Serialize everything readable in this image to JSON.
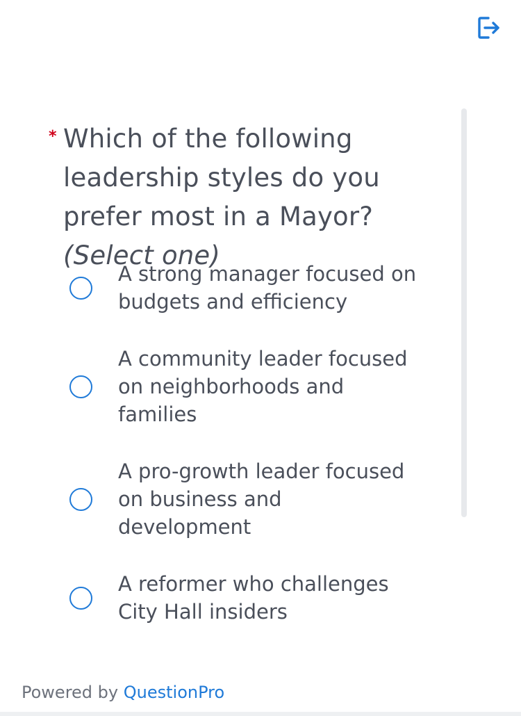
{
  "header": {
    "exit_icon": "exit-icon"
  },
  "question": {
    "required_mark": "*",
    "text": "Which of the following leadership styles do you prefer most in a Mayor?",
    "hint": "(Select one)"
  },
  "options": [
    {
      "label": "A strong manager focused on budgets and efficiency",
      "selected": false
    },
    {
      "label": "A community leader focused on neighborhoods and families",
      "selected": false
    },
    {
      "label": "A pro-growth leader focused on business and development",
      "selected": false
    },
    {
      "label": "A reformer who challenges City Hall insiders",
      "selected": false
    }
  ],
  "footer": {
    "powered_by": "Powered by",
    "brand": "QuestionPro"
  },
  "colors": {
    "accent": "#1f7ad8",
    "required": "#d0021b",
    "text": "#4a4f5a"
  }
}
